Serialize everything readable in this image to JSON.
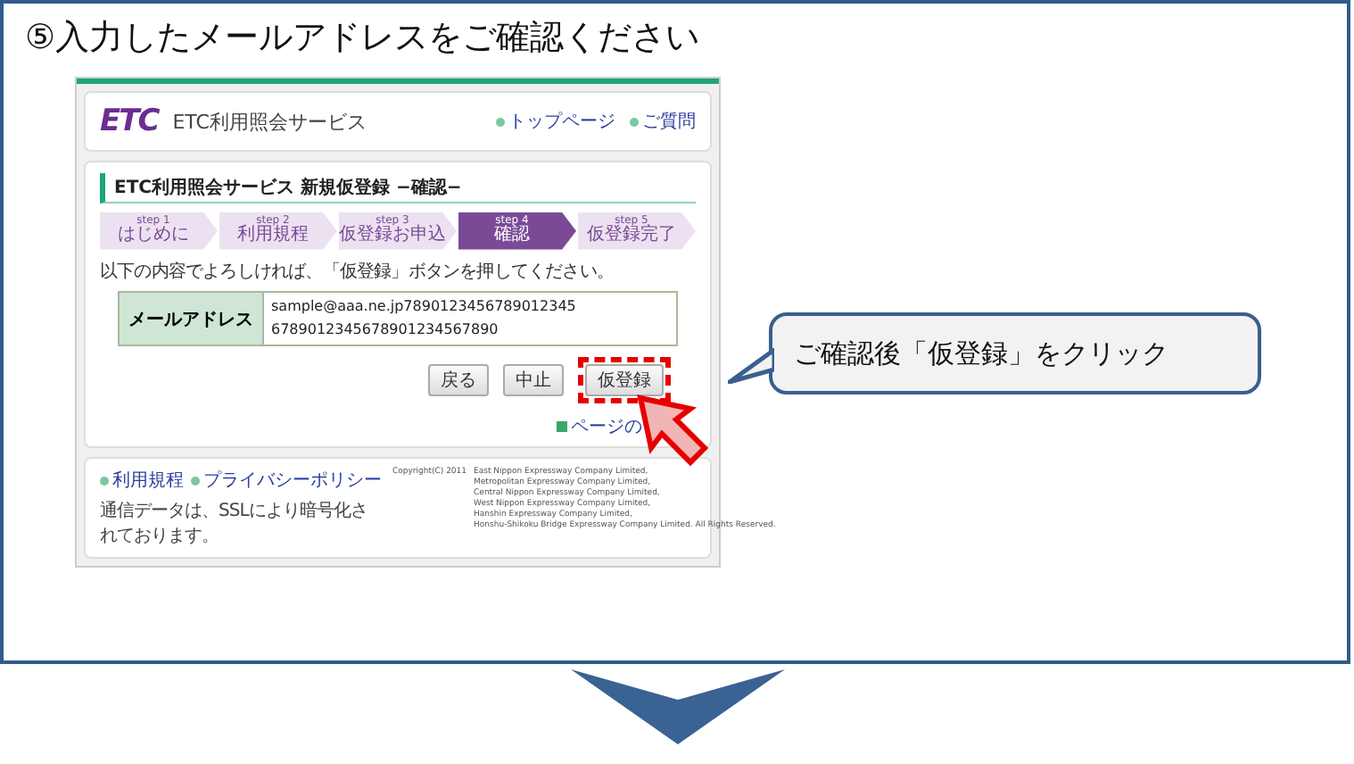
{
  "title": "⑤入力したメールアドレスをご確認ください",
  "site": {
    "logo": "ETC",
    "name": "ETC利用照会サービス",
    "header_links": [
      "トップページ",
      "ご質問"
    ],
    "heading": "ETC利用照会サービス 新規仮登録 −確認−",
    "steps": [
      {
        "step": "step 1",
        "label": "はじめに",
        "selected": false
      },
      {
        "step": "step 2",
        "label": "利用規程",
        "selected": false
      },
      {
        "step": "step 3",
        "label": "仮登録お申込",
        "selected": false
      },
      {
        "step": "step 4",
        "label": "確認",
        "selected": true
      },
      {
        "step": "step 5",
        "label": "仮登録完了",
        "selected": false
      }
    ],
    "instruction": "以下の内容でよろしければ、「仮登録」ボタンを押してください。",
    "fields": [
      {
        "label": "メールアドレス",
        "value_lines": [
          "sample@aaa.ne.jp7890123456789012345",
          "6789012345678901234567890"
        ]
      }
    ],
    "buttons": [
      {
        "label": "戻る",
        "highlighted": false
      },
      {
        "label": "中止",
        "highlighted": false
      },
      {
        "label": "仮登録",
        "highlighted": true
      }
    ],
    "page_top": "ページの",
    "footer": {
      "links": [
        "利用規程",
        "プライバシーポリシー"
      ],
      "note": "通信データは、SSLにより暗号化されております。",
      "copyright": "Copyright(C) 2011",
      "companies": [
        "East Nippon Expressway Company Limited,",
        "Metropolitan Expressway Company Limited,",
        "Central Nippon Expressway Company Limited,",
        "West Nippon Expressway Company Limited,",
        "Hanshin Expressway Company Limited,",
        "Honshu-Shikoku Bridge Expressway Company Limited. All Rights Reserved."
      ]
    }
  },
  "callout": "ご確認後「仮登録」をクリック"
}
